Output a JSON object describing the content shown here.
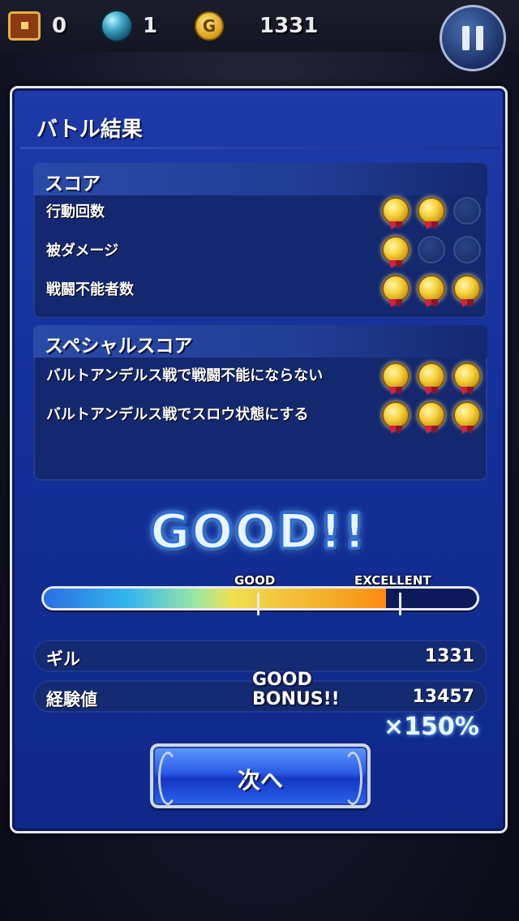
{
  "hud": {
    "chest_count": "0",
    "orb_count": "1",
    "gil_icon": "G",
    "gil": "1331"
  },
  "panel": {
    "title": "バトル結果"
  },
  "score": {
    "title": "スコア",
    "rows": [
      {
        "label": "行動回数",
        "medals": 2
      },
      {
        "label": "被ダメージ",
        "medals": 1
      },
      {
        "label": "戦闘不能者数",
        "medals": 3
      }
    ]
  },
  "special_score": {
    "title": "スペシャルスコア",
    "rows": [
      {
        "label": "バルトアンデルス戦で戦闘不能にならない",
        "medals": 3
      },
      {
        "label": "バルトアンデルス戦でスロウ状態にする",
        "medals": 3
      }
    ]
  },
  "rank": {
    "text": "GOOD!!",
    "gauge_fill": 0.79,
    "good_label": "GOOD",
    "excellent_label": "EXCELLENT"
  },
  "results": {
    "gil_label": "ギル",
    "gil_value": "1331",
    "exp_label": "経験値",
    "exp_value": "13457",
    "bonus_line1": "GOOD",
    "bonus_line2": "BONUS!!",
    "multiplier": "×150%"
  },
  "next_button": "次へ",
  "colors": {
    "panel": "#14309a",
    "medal_gold": "#f5d23a",
    "button_blue": "#2a5ae6"
  }
}
